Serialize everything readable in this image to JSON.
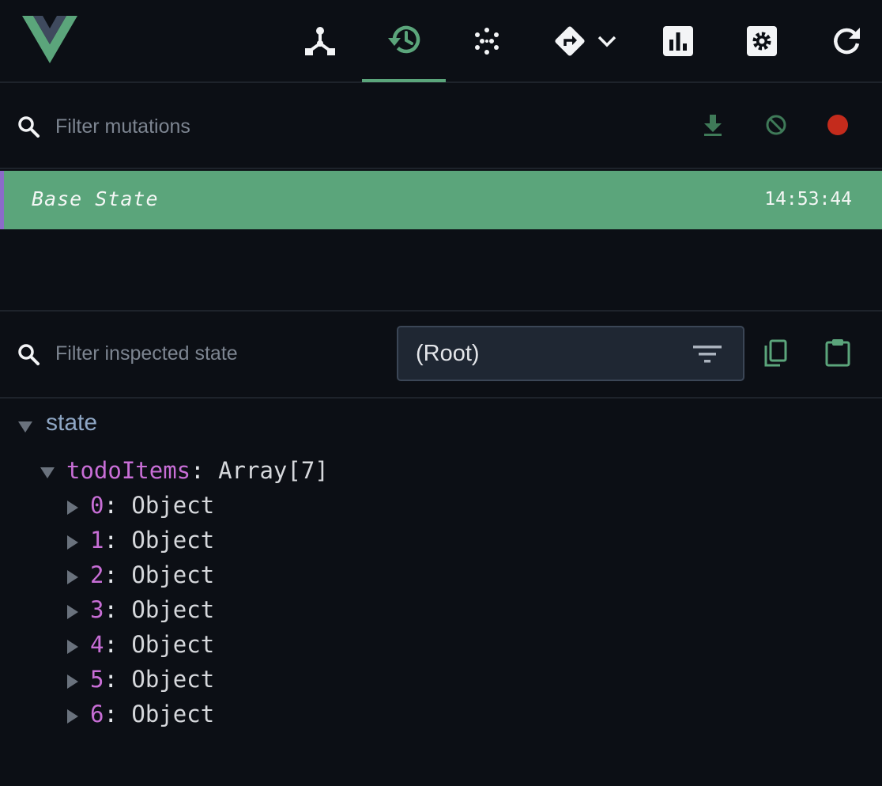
{
  "toolbar": {
    "logo": "vue-logo",
    "tools": [
      {
        "icon": "component-tree-icon"
      },
      {
        "icon": "history-icon",
        "active": true
      },
      {
        "icon": "events-dots-icon"
      },
      {
        "icon": "routing-icon"
      },
      {
        "icon": "chevron-down-icon"
      },
      {
        "icon": "performance-chart-icon"
      },
      {
        "icon": "settings-icon"
      },
      {
        "icon": "refresh-icon"
      }
    ]
  },
  "mutations": {
    "filter_placeholder": "Filter mutations",
    "actions": [
      "download-icon",
      "clear-icon",
      "record-icon"
    ],
    "selected": {
      "name": "Base State",
      "time": "14:53:44"
    }
  },
  "inspector": {
    "filter_placeholder": "Filter inspected state",
    "select_value": "(Root)",
    "actions": [
      "copy-icon",
      "paste-icon"
    ]
  },
  "state_tree": {
    "root_label": "state",
    "array": {
      "key": "todoItems",
      "type": "Array[7]"
    },
    "items": [
      {
        "key": "0",
        "value": "Object"
      },
      {
        "key": "1",
        "value": "Object"
      },
      {
        "key": "2",
        "value": "Object"
      },
      {
        "key": "3",
        "value": "Object"
      },
      {
        "key": "4",
        "value": "Object"
      },
      {
        "key": "5",
        "value": "Object"
      },
      {
        "key": "6",
        "value": "Object"
      }
    ]
  },
  "colors": {
    "background": "#0c0f15",
    "accent": "#5ba57b",
    "record": "#c42b1c",
    "key": "#c86ed6",
    "state_label": "#8ea6c4"
  }
}
